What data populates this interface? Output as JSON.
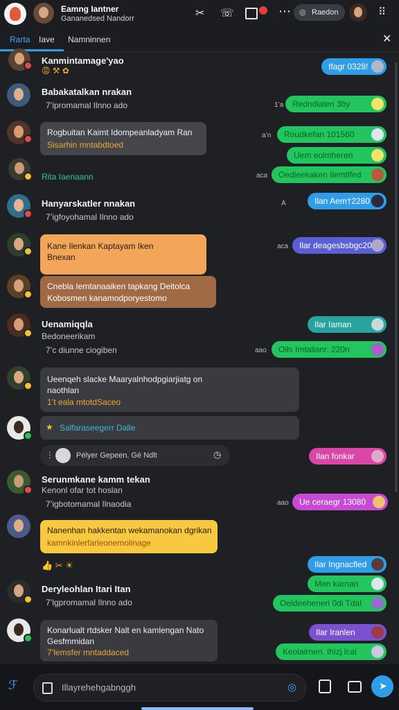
{
  "header": {
    "title": "Eamng Iantner",
    "subtitle": "Gananedsed Nandorr",
    "search_label": "Raedon"
  },
  "tabs": [
    {
      "label": "Rarta"
    },
    {
      "label": "Iave"
    },
    {
      "label": "Namninnen"
    }
  ],
  "left_messages": [
    {
      "name": "Kanmintamage'yao",
      "sub": ""
    },
    {
      "name": "Babakatalkan nrakan",
      "sub": "7’ipromamal Ilnno ado"
    },
    {
      "name": "Rogbuitan Kaimt Idompeanladyam Ran",
      "sub": "Sisarhin mntabdtoed"
    },
    {
      "name": "Rita Iaenaann",
      "sub": ""
    },
    {
      "name": "Hanyarskatler nnakan",
      "sub": "7’igfoyohamal Ilnno ado"
    },
    {
      "name": "Kane Ilenkan Kaptayam Iken",
      "sub": "Bnexan"
    },
    {
      "name": "Cnebla Iemtanaaiken tapkang Deitolca",
      "sub": "Kobosmen kanamodporyestomo"
    },
    {
      "name": "Uenamiqqla",
      "sub": "Bedoneerikam"
    },
    {
      "name": "7’c diunne ciogiben",
      "sub": ""
    },
    {
      "name": "Ueenqeh slacke Maaryalnhodpgiarjiatg on",
      "sub": "naothlan"
    },
    {
      "name": "1’t eala mtotdSaceo",
      "sub": ""
    },
    {
      "name": "Salfaraseegerr Dalle",
      "sub": ""
    },
    {
      "name": "Pélyer Gepeen. Gé Ndlt",
      "sub": ""
    },
    {
      "name": "Serunmkane kamm tekan",
      "sub": "Kenonl ofar tot hoslan"
    },
    {
      "name": "7’igbotomamal Ilnaodia",
      "sub": ""
    },
    {
      "name": "Nanenhan hakkentan wekamanokan dgrikan",
      "sub": "kamnkinlerfarleonemolinage"
    },
    {
      "name": "Deryleohlan Itari Itan",
      "sub": "7’lgpromamal Ilnno ado"
    },
    {
      "name": "Konarlualt rtdsker Nalt en kamlengan Nato",
      "sub": "Gesfmmidan"
    },
    {
      "name": "7’lemsfer mntaddaced",
      "sub": ""
    }
  ],
  "timestamps": [
    "1’a",
    "a’n",
    "aca",
    "A",
    "aca",
    "aao",
    "aao",
    "ao"
  ],
  "right_messages": [
    "Ifagr 0328!",
    "Redndialen 3by",
    "Roudkefan 101560",
    "Uem eolmheren",
    "Oedleekaken Ilemtlfed",
    "Ilan Aem†2280",
    "Ilar deagesbsbgc20",
    "Ilar Iaman",
    "Oils Imtalianr. 220n",
    "Ilan fonkar",
    "Ue ceraegr 13080",
    "Ilar Ingnacfled",
    "Men karnan",
    "Oeldeeheneri 0di Tdal",
    "Ilar Iranlen",
    "Keolairnen. Ihizj lcai"
  ],
  "composer": {
    "placeholder": "Illayrehehgabnggh"
  },
  "colors": {
    "bg": "#1f2023",
    "green": "#22c55e",
    "blue": "#2f9de8",
    "violet": "#5b5fd6",
    "teal": "#27a3a0",
    "pink": "#d946a8",
    "magenta": "#c64ad4",
    "orange": "#f2a65a",
    "tan": "#a06a45",
    "yellow": "#f7c840",
    "gray": "#3a3b40"
  }
}
